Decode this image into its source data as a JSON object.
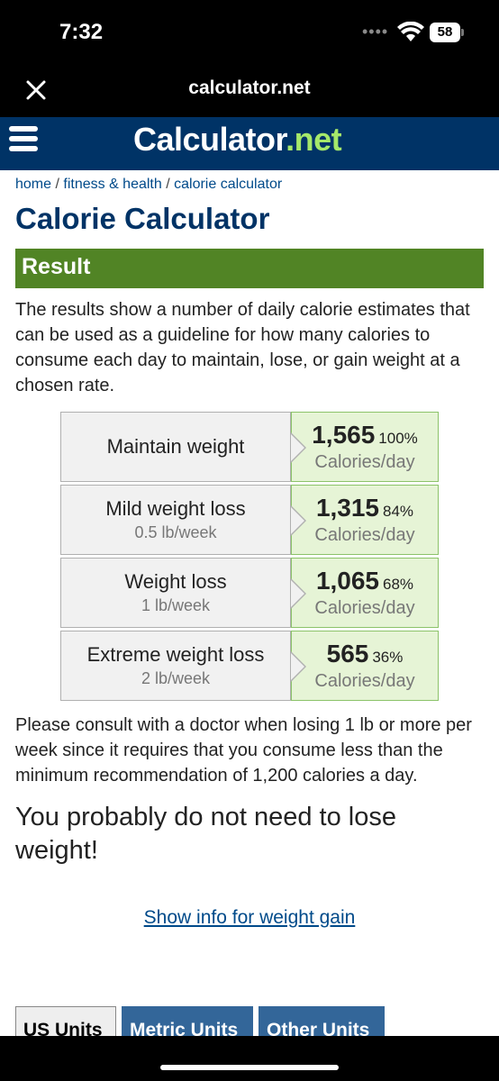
{
  "status": {
    "time": "7:32",
    "battery": "58"
  },
  "browser": {
    "url": "calculator.net"
  },
  "site": {
    "logo_main": "Calculator",
    "logo_dot": ".",
    "logo_tld": "net"
  },
  "breadcrumb": {
    "home": "home",
    "sep": " / ",
    "section": "fitness & health",
    "page": "calorie calculator"
  },
  "page_title": "Calorie Calculator",
  "result_heading": "Result",
  "intro_text": "The results show a number of daily calorie estimates that can be used as a guideline for how many calories to consume each day to maintain, lose, or gain weight at a chosen rate.",
  "results": [
    {
      "label": "Maintain weight",
      "sub": "",
      "value": "1,565",
      "percent": "100%",
      "unit": "Calories/day"
    },
    {
      "label": "Mild weight loss",
      "sub": "0.5 lb/week",
      "value": "1,315",
      "percent": "84%",
      "unit": "Calories/day"
    },
    {
      "label": "Weight loss",
      "sub": "1 lb/week",
      "value": "1,065",
      "percent": "68%",
      "unit": "Calories/day"
    },
    {
      "label": "Extreme weight loss",
      "sub": "2 lb/week",
      "value": "565",
      "percent": "36%",
      "unit": "Calories/day"
    }
  ],
  "consult_text": "Please consult with a doctor when losing 1 lb or more per week since it requires that you consume less than the minimum recommendation of 1,200 calories a day.",
  "verdict_text": "You probably do not need to lose weight!",
  "gain_link": "Show info for weight gain",
  "tabs": {
    "us": "US Units",
    "metric": "Metric Units",
    "other": "Other Units"
  },
  "colors": {
    "header": "#003366",
    "result_bar": "#518425",
    "value_bg": "#e6f4d6",
    "logo_tld": "#a5e86a"
  }
}
